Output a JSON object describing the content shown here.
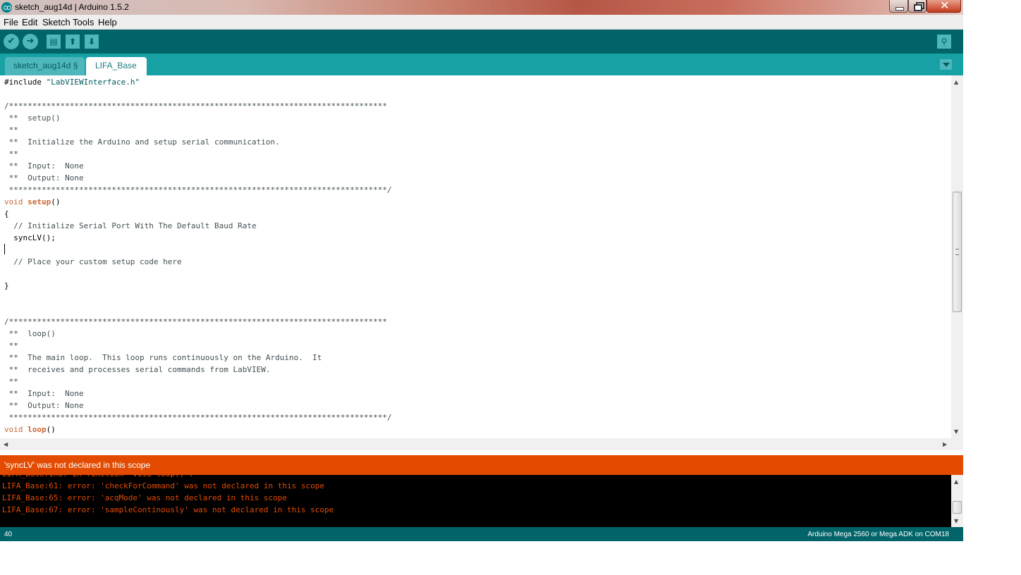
{
  "window": {
    "title": "sketch_aug14d | Arduino 1.5.2",
    "close_glyph": "✕"
  },
  "menu": [
    "File",
    "Edit",
    "Sketch",
    "Tools",
    "Help"
  ],
  "toolbar": {
    "buttons": [
      {
        "name": "verify",
        "icon": "checkmark-icon",
        "glyph": "✔"
      },
      {
        "name": "upload",
        "icon": "right-arrow-icon",
        "glyph": "➜"
      },
      {
        "name": "new",
        "icon": "new-file-icon",
        "glyph": "▤"
      },
      {
        "name": "open",
        "icon": "up-arrow-icon",
        "glyph": "⬆"
      },
      {
        "name": "save",
        "icon": "down-arrow-icon",
        "glyph": "⬇"
      }
    ],
    "serial_monitor": {
      "icon": "magnifier-icon",
      "glyph": "⚲"
    }
  },
  "tabs": [
    {
      "label": "sketch_aug14d §",
      "active": false
    },
    {
      "label": "LIFA_Base",
      "active": true
    }
  ],
  "editor": {
    "lines": [
      [
        [
          "pl",
          "#include "
        ],
        [
          "str",
          "\"LabVIEWInterface.h\""
        ]
      ],
      [],
      [
        [
          "cm",
          "/*********************************************************************************"
        ]
      ],
      [
        [
          "cm",
          " **  setup()"
        ]
      ],
      [
        [
          "cm",
          " **"
        ]
      ],
      [
        [
          "cm",
          " **  Initialize the Arduino and setup serial communication."
        ]
      ],
      [
        [
          "cm",
          " **"
        ]
      ],
      [
        [
          "cm",
          " **  Input:  None"
        ]
      ],
      [
        [
          "cm",
          " **  Output: None"
        ]
      ],
      [
        [
          "cm",
          " *********************************************************************************/"
        ]
      ],
      [
        [
          "kw",
          "void"
        ],
        [
          "pl",
          " "
        ],
        [
          "fn",
          "setup"
        ],
        [
          "pl",
          "()"
        ]
      ],
      [
        [
          "pl",
          "{"
        ]
      ],
      [
        [
          "cm",
          "  // Initialize Serial Port With The Default Baud Rate"
        ]
      ],
      [
        [
          "pl",
          "  syncLV();"
        ]
      ],
      [],
      [
        [
          "cm",
          "  // Place your custom setup code here"
        ]
      ],
      [],
      [
        [
          "pl",
          "}"
        ]
      ],
      [],
      [],
      [
        [
          "cm",
          "/*********************************************************************************"
        ]
      ],
      [
        [
          "cm",
          " **  loop()"
        ]
      ],
      [
        [
          "cm",
          " **"
        ]
      ],
      [
        [
          "cm",
          " **  The main loop.  This loop runs continuously on the Arduino.  It"
        ]
      ],
      [
        [
          "cm",
          " **  receives and processes serial commands from LabVIEW."
        ]
      ],
      [
        [
          "cm",
          " **"
        ]
      ],
      [
        [
          "cm",
          " **  Input:  None"
        ]
      ],
      [
        [
          "cm",
          " **  Output: None"
        ]
      ],
      [
        [
          "cm",
          " *********************************************************************************/"
        ]
      ],
      [
        [
          "kw",
          "void"
        ],
        [
          "pl",
          " "
        ],
        [
          "fn",
          "loop"
        ],
        [
          "pl",
          "()"
        ]
      ]
    ]
  },
  "scroll_arrows": {
    "up": "▲",
    "down": "▼",
    "left": "◀",
    "right": "▶"
  },
  "status": {
    "message": "'syncLV' was not declared in this scope"
  },
  "console": {
    "lines": [
      "LIFA_Base.ino: In function 'void loop()':",
      "LIFA_Base:61: error: 'checkForCommand' was not declared in this scope",
      "LIFA_Base:65: error: 'acqMode' was not declared in this scope",
      "LIFA_Base:67: error: 'sampleContinously' was not declared in this scope"
    ]
  },
  "footer": {
    "line_number": "40",
    "board": "Arduino Mega 2560 or Mega ADK on COM18"
  }
}
